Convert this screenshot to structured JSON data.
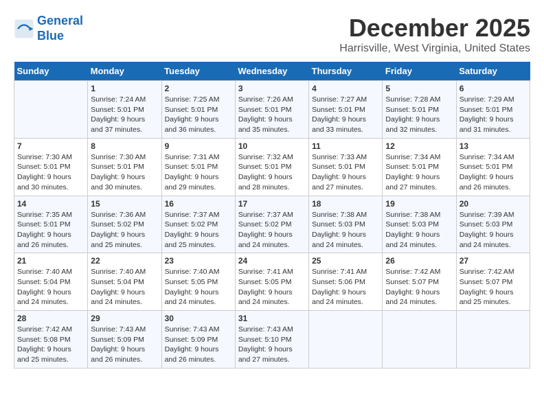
{
  "header": {
    "logo_line1": "General",
    "logo_line2": "Blue",
    "month": "December 2025",
    "location": "Harrisville, West Virginia, United States"
  },
  "days_of_week": [
    "Sunday",
    "Monday",
    "Tuesday",
    "Wednesday",
    "Thursday",
    "Friday",
    "Saturday"
  ],
  "weeks": [
    [
      {
        "day": "",
        "info": ""
      },
      {
        "day": "1",
        "info": "Sunrise: 7:24 AM\nSunset: 5:01 PM\nDaylight: 9 hours\nand 37 minutes."
      },
      {
        "day": "2",
        "info": "Sunrise: 7:25 AM\nSunset: 5:01 PM\nDaylight: 9 hours\nand 36 minutes."
      },
      {
        "day": "3",
        "info": "Sunrise: 7:26 AM\nSunset: 5:01 PM\nDaylight: 9 hours\nand 35 minutes."
      },
      {
        "day": "4",
        "info": "Sunrise: 7:27 AM\nSunset: 5:01 PM\nDaylight: 9 hours\nand 33 minutes."
      },
      {
        "day": "5",
        "info": "Sunrise: 7:28 AM\nSunset: 5:01 PM\nDaylight: 9 hours\nand 32 minutes."
      },
      {
        "day": "6",
        "info": "Sunrise: 7:29 AM\nSunset: 5:01 PM\nDaylight: 9 hours\nand 31 minutes."
      }
    ],
    [
      {
        "day": "7",
        "info": "Sunrise: 7:30 AM\nSunset: 5:01 PM\nDaylight: 9 hours\nand 30 minutes."
      },
      {
        "day": "8",
        "info": "Sunrise: 7:30 AM\nSunset: 5:01 PM\nDaylight: 9 hours\nand 30 minutes."
      },
      {
        "day": "9",
        "info": "Sunrise: 7:31 AM\nSunset: 5:01 PM\nDaylight: 9 hours\nand 29 minutes."
      },
      {
        "day": "10",
        "info": "Sunrise: 7:32 AM\nSunset: 5:01 PM\nDaylight: 9 hours\nand 28 minutes."
      },
      {
        "day": "11",
        "info": "Sunrise: 7:33 AM\nSunset: 5:01 PM\nDaylight: 9 hours\nand 27 minutes."
      },
      {
        "day": "12",
        "info": "Sunrise: 7:34 AM\nSunset: 5:01 PM\nDaylight: 9 hours\nand 27 minutes."
      },
      {
        "day": "13",
        "info": "Sunrise: 7:34 AM\nSunset: 5:01 PM\nDaylight: 9 hours\nand 26 minutes."
      }
    ],
    [
      {
        "day": "14",
        "info": "Sunrise: 7:35 AM\nSunset: 5:01 PM\nDaylight: 9 hours\nand 26 minutes."
      },
      {
        "day": "15",
        "info": "Sunrise: 7:36 AM\nSunset: 5:02 PM\nDaylight: 9 hours\nand 25 minutes."
      },
      {
        "day": "16",
        "info": "Sunrise: 7:37 AM\nSunset: 5:02 PM\nDaylight: 9 hours\nand 25 minutes."
      },
      {
        "day": "17",
        "info": "Sunrise: 7:37 AM\nSunset: 5:02 PM\nDaylight: 9 hours\nand 24 minutes."
      },
      {
        "day": "18",
        "info": "Sunrise: 7:38 AM\nSunset: 5:03 PM\nDaylight: 9 hours\nand 24 minutes."
      },
      {
        "day": "19",
        "info": "Sunrise: 7:38 AM\nSunset: 5:03 PM\nDaylight: 9 hours\nand 24 minutes."
      },
      {
        "day": "20",
        "info": "Sunrise: 7:39 AM\nSunset: 5:03 PM\nDaylight: 9 hours\nand 24 minutes."
      }
    ],
    [
      {
        "day": "21",
        "info": "Sunrise: 7:40 AM\nSunset: 5:04 PM\nDaylight: 9 hours\nand 24 minutes."
      },
      {
        "day": "22",
        "info": "Sunrise: 7:40 AM\nSunset: 5:04 PM\nDaylight: 9 hours\nand 24 minutes."
      },
      {
        "day": "23",
        "info": "Sunrise: 7:40 AM\nSunset: 5:05 PM\nDaylight: 9 hours\nand 24 minutes."
      },
      {
        "day": "24",
        "info": "Sunrise: 7:41 AM\nSunset: 5:05 PM\nDaylight: 9 hours\nand 24 minutes."
      },
      {
        "day": "25",
        "info": "Sunrise: 7:41 AM\nSunset: 5:06 PM\nDaylight: 9 hours\nand 24 minutes."
      },
      {
        "day": "26",
        "info": "Sunrise: 7:42 AM\nSunset: 5:07 PM\nDaylight: 9 hours\nand 24 minutes."
      },
      {
        "day": "27",
        "info": "Sunrise: 7:42 AM\nSunset: 5:07 PM\nDaylight: 9 hours\nand 25 minutes."
      }
    ],
    [
      {
        "day": "28",
        "info": "Sunrise: 7:42 AM\nSunset: 5:08 PM\nDaylight: 9 hours\nand 25 minutes."
      },
      {
        "day": "29",
        "info": "Sunrise: 7:43 AM\nSunset: 5:09 PM\nDaylight: 9 hours\nand 26 minutes."
      },
      {
        "day": "30",
        "info": "Sunrise: 7:43 AM\nSunset: 5:09 PM\nDaylight: 9 hours\nand 26 minutes."
      },
      {
        "day": "31",
        "info": "Sunrise: 7:43 AM\nSunset: 5:10 PM\nDaylight: 9 hours\nand 27 minutes."
      },
      {
        "day": "",
        "info": ""
      },
      {
        "day": "",
        "info": ""
      },
      {
        "day": "",
        "info": ""
      }
    ]
  ]
}
